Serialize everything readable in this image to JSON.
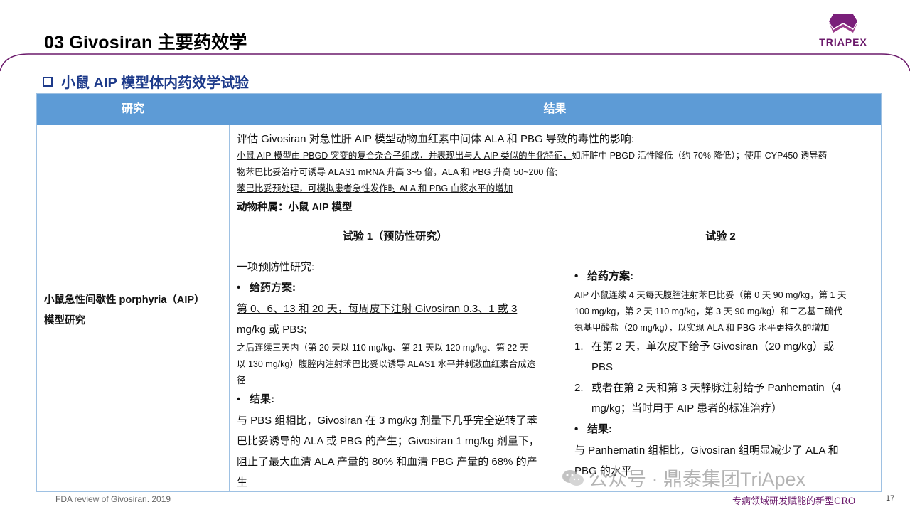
{
  "header": {
    "title": "03 Givosiran 主要药效学",
    "logo_text": "TRIAPEX"
  },
  "section": {
    "heading": "小鼠 AIP 模型体内药效学试验"
  },
  "table": {
    "col_study": "研究",
    "col_result": "结果",
    "study_name_line1": "小鼠急性间歇性 porphyria（AIP）",
    "study_name_line2": "模型研究",
    "intro": {
      "title": "评估 Givosiran 对急性肝 AIP 模型动物血红素中间体 ALA 和 PBG 导致的毒性的影响:",
      "line1": "小鼠 AIP 模型由 PBGD 突变的复合杂合子组成，并表现出与人 AIP 类似的生化特征，",
      "line1b": "如肝脏中 PBGD 活性降低（约 70% 降低）；使用 CYP450 诱导药",
      "line2": "物苯巴比妥治疗可诱导 ALAS1 mRNA 升高 3~5 倍，ALA 和 PBG 升高 50~200 倍;",
      "line3": "苯巴比妥预处理，可模拟患者急性发作时 ALA 和 PBG 血浆水平的增加",
      "species": "动物种属：小鼠 AIP 模型"
    },
    "trial1": {
      "head": "试验 1（预防性研究）",
      "lead": "一项预防性研究:",
      "dosing_label": "给药方案:",
      "dosing_line1": "第 0、6、13 和 20 天，每周皮下注射 Givosiran 0.3、1 或 3",
      "dosing_line2a": "mg/kg",
      "dosing_line2b": " 或 PBS;",
      "followup1": "之后连续三天内（第 20 天以 110 mg/kg、第 21 天以 120 mg/kg、第 22 天",
      "followup2": "以 130 mg/kg）腹腔内注射苯巴比妥以诱导 ALAS1 水平并刺激血红素合成途",
      "followup3": "径",
      "result_label": "结果:",
      "result1": "与 PBS 组相比，Givosiran 在 3 mg/kg 剂量下几乎完全逆转了苯",
      "result2": "巴比妥诱导的 ALA 或 PBG 的产生；Givosiran 1 mg/kg 剂量下，",
      "result3": "阻止了最大血清 ALA 产量的 80% 和血清 PBG 产量的 68% 的产",
      "result4": "生"
    },
    "trial2": {
      "head": "试验 2",
      "dosing_label": "给药方案:",
      "dosing1": "AIP 小鼠连续 4 天每天腹腔注射苯巴比妥（第 0 天 90 mg/kg，第 1 天",
      "dosing2": "100 mg/kg，第 2 天 110 mg/kg，第 3 天 90 mg/kg）和二乙基二硫代",
      "dosing3": "氨基甲酸盐（20 mg/kg），以实现 ALA 和 PBG 水平更持久的增加",
      "item1_num": "1.",
      "item1_a": "在",
      "item1_b": "第 2 天，单次皮下给予 Givosiran（20 mg/kg）",
      "item1_c": "或",
      "item1_d": "PBS",
      "item2_num": "2.",
      "item2_a": "或者在第 2 天和第 3 天静脉注射给予 Panhematin（4",
      "item2_b": "mg/kg；当时用于 AIP 患者的标准治疗）",
      "result_label": "结果:",
      "result1": "与 Panhematin 组相比，Givosiran 组明显减少了 ALA 和",
      "result2": "PBG 的水平"
    }
  },
  "footer": {
    "source": "FDA review of Givosiran. 2019",
    "watermark": "公众号 · 鼎泰集团TriApex",
    "tagline": "专病领域研发赋能的新型CRO",
    "page": "17"
  },
  "colors": {
    "header_blue": "#5d9bd6",
    "heading_blue": "#1d3a8a",
    "brand_purple": "#6b1a6b"
  }
}
